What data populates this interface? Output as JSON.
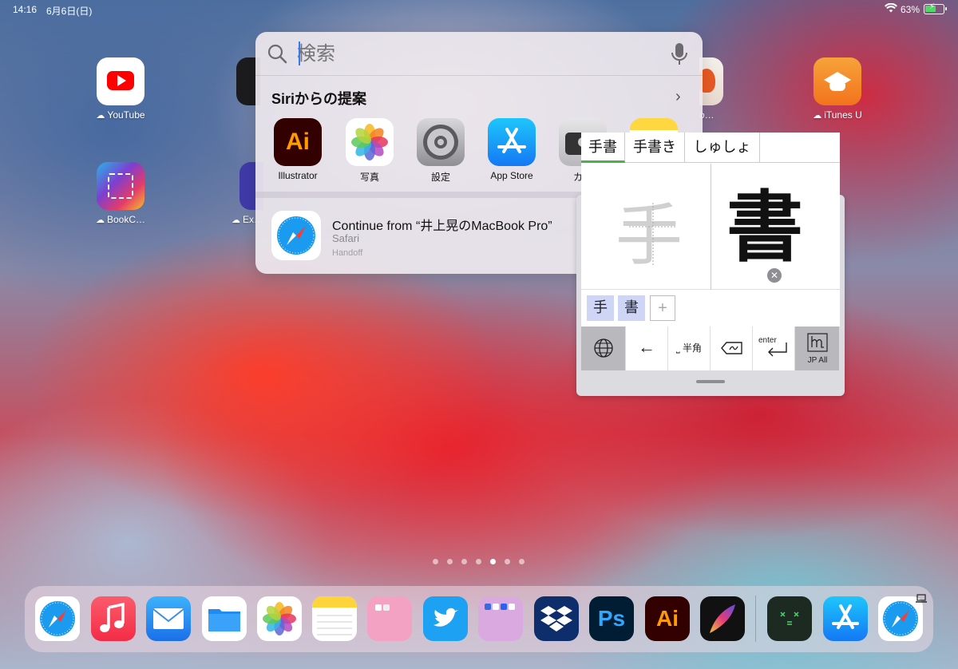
{
  "status_bar": {
    "time": "14:16",
    "date": "6月6日(日)",
    "battery_percent": "63%",
    "battery_level": 0.63,
    "wifi_icon": "wifi-icon",
    "battery_icon": "battery-charging-icon"
  },
  "home_apps": [
    {
      "label": "YouTube",
      "icon": "youtube-icon",
      "downloading": true
    },
    {
      "label": "iTunes U",
      "icon": "itunes-u-icon",
      "downloading": true
    },
    {
      "label": "BookC…",
      "icon": "book-creator-icon",
      "downloading": true
    },
    {
      "label": "Ex…",
      "icon": "app-icon",
      "downloading": true
    },
    {
      "label": "o…",
      "icon": "app-icon"
    }
  ],
  "spotlight": {
    "search_placeholder": "検索",
    "siri_title": "Siriからの提案",
    "suggestions": [
      {
        "label": "Illustrator",
        "icon": "illustrator-icon"
      },
      {
        "label": "写真",
        "icon": "photos-icon"
      },
      {
        "label": "設定",
        "icon": "settings-icon"
      },
      {
        "label": "App Store",
        "icon": "app-store-icon"
      },
      {
        "label": "カメ",
        "icon": "camera-icon"
      },
      {
        "label": "",
        "icon": "notes-icon"
      }
    ],
    "handoff": {
      "title": "Continue from “井上晃のMacBook Pro”",
      "app": "Safari",
      "subtitle": "Handoff",
      "icon": "safari-icon"
    }
  },
  "handwriting_keyboard": {
    "candidates": [
      "手書",
      "手書き",
      "しゅしょ"
    ],
    "ghost_char": "手",
    "ink_char": "書",
    "chips": [
      "手",
      "書"
    ],
    "add_chip": "+",
    "keys": {
      "globe": "globe-icon",
      "left_arrow": "←",
      "space": "⎵ 半角",
      "delete": "delete-icon",
      "enter": "enter",
      "mode": "JP All"
    }
  },
  "page_dots": {
    "count": 7,
    "active": 4
  },
  "dock": [
    {
      "name": "Safari",
      "icon": "safari-icon"
    },
    {
      "name": "Music",
      "icon": "music-icon"
    },
    {
      "name": "Mail",
      "icon": "mail-icon"
    },
    {
      "name": "Files",
      "icon": "files-icon"
    },
    {
      "name": "Photos",
      "icon": "photos-icon"
    },
    {
      "name": "Notes",
      "icon": "notes-icon"
    },
    {
      "name": "Folder",
      "icon": "folder-icon"
    },
    {
      "name": "Twitter",
      "icon": "twitter-icon"
    },
    {
      "name": "Folder",
      "icon": "folder-icon"
    },
    {
      "name": "Dropbox",
      "icon": "dropbox-icon"
    },
    {
      "name": "Photoshop",
      "icon": "photoshop-icon",
      "text": "Ps"
    },
    {
      "name": "Illustrator",
      "icon": "illustrator-icon",
      "text": "Ai"
    },
    {
      "name": "Procreate",
      "icon": "procreate-icon"
    },
    {
      "name": "Terminal",
      "icon": "terminal-icon"
    },
    {
      "name": "App Store",
      "icon": "app-store-icon"
    },
    {
      "name": "Safari",
      "icon": "safari-icon",
      "handoff_badge": true
    }
  ]
}
